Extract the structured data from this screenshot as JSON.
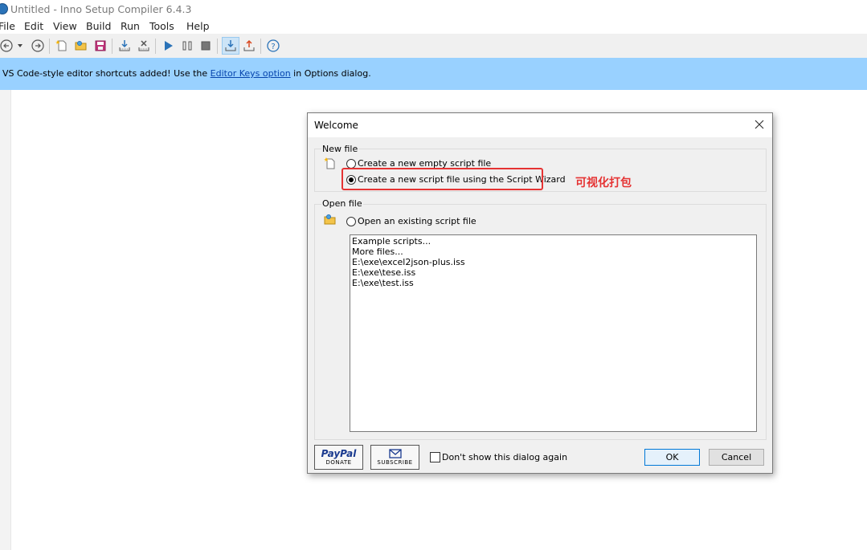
{
  "window": {
    "title": "Untitled - Inno Setup Compiler 6.4.3"
  },
  "menu": [
    "File",
    "Edit",
    "View",
    "Build",
    "Run",
    "Tools",
    "Help"
  ],
  "toolbar": {
    "icons": [
      "back-icon",
      "dropdown-icon",
      "forward-icon",
      "new-file-icon",
      "open-file-icon",
      "save-icon",
      "compile-icon",
      "stop-compile-icon",
      "run-icon",
      "pause-icon",
      "stop-icon",
      "target-download-icon",
      "target-upload-icon",
      "help-icon"
    ]
  },
  "notice": {
    "prefix": "VS Code-style editor shortcuts added! Use the ",
    "link": "Editor Keys option",
    "suffix": " in Options dialog.",
    "background": "#99d1ff"
  },
  "dialog": {
    "title": "Welcome",
    "new_file_label": "New file",
    "radio_empty": "Create a new empty script file",
    "radio_wizard": "Create a new script file using the Script Wizard",
    "open_file_label": "Open file",
    "radio_open": "Open an existing script file",
    "files": [
      "Example scripts...",
      "More files...",
      "E:\\exe\\excel2json-plus.iss",
      "E:\\exe\\tese.iss",
      "E:\\exe\\test.iss"
    ],
    "paypal_brand": "PayPal",
    "paypal_sub": "DONATE",
    "subscribe_label": "SUBSCRIBE",
    "dont_show": "Don't show this dialog again",
    "ok": "OK",
    "cancel": "Cancel"
  },
  "annotation": {
    "text": "可视化打包",
    "color": "#e53333"
  }
}
